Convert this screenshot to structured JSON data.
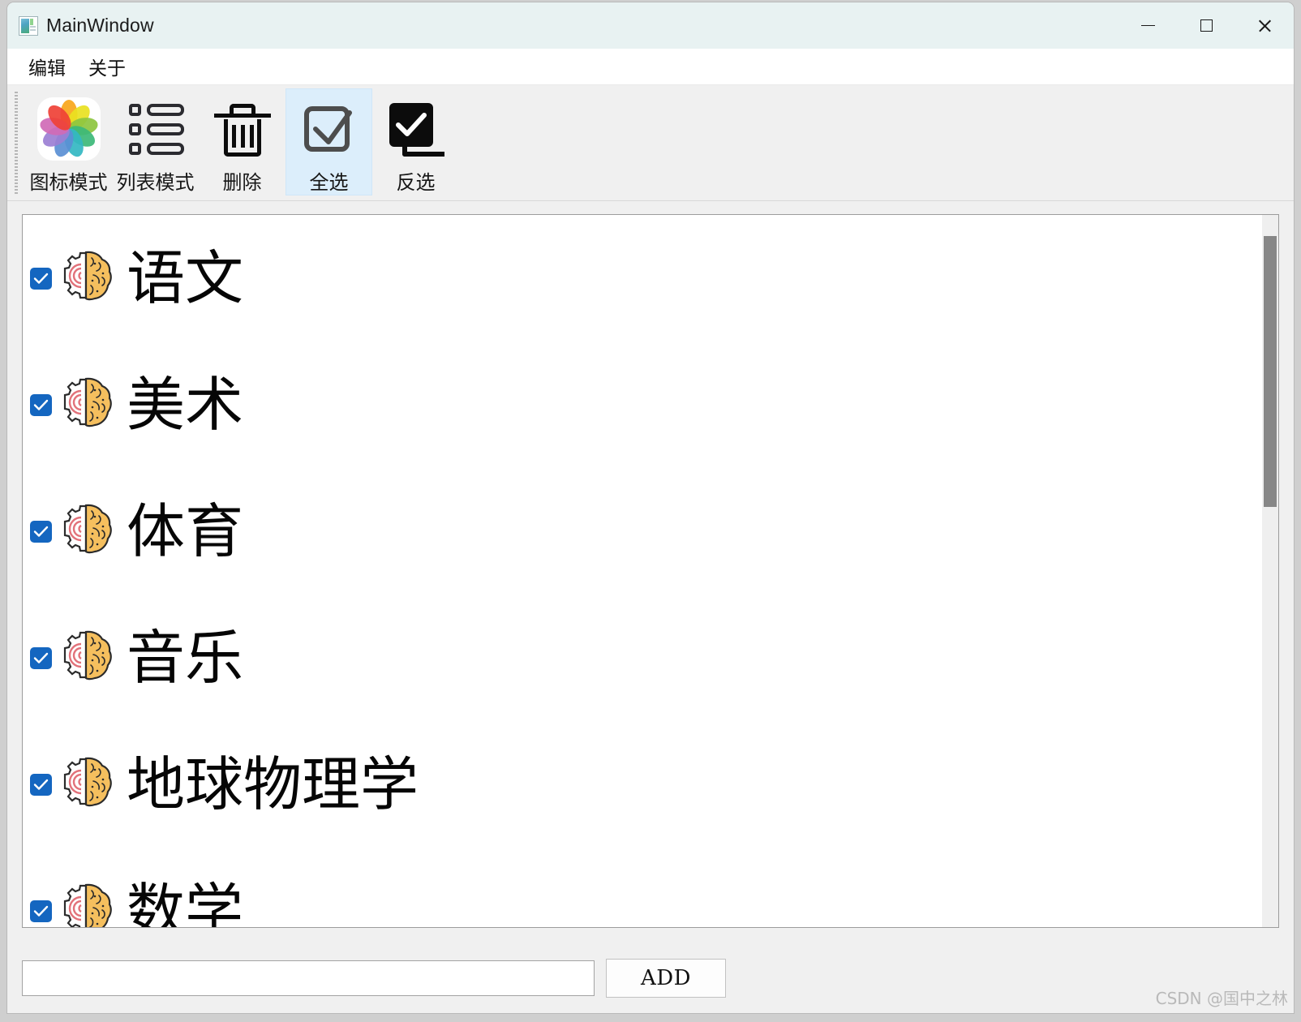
{
  "window": {
    "title": "MainWindow",
    "app_icon": "app-window-icon",
    "controls": {
      "minimize": "minimize-icon",
      "maximize": "maximize-icon",
      "close": "close-icon"
    }
  },
  "menubar": {
    "items": [
      {
        "label": "编辑",
        "name": "menu-edit"
      },
      {
        "label": "关于",
        "name": "menu-about"
      }
    ]
  },
  "toolbar": {
    "buttons": [
      {
        "label": "图标模式",
        "icon": "photos-grid-icon",
        "selected": false
      },
      {
        "label": "列表模式",
        "icon": "list-view-icon",
        "selected": false
      },
      {
        "label": "删除",
        "icon": "trash-icon",
        "selected": false
      },
      {
        "label": "全选",
        "icon": "checkbox-check-icon",
        "selected": true
      },
      {
        "label": "反选",
        "icon": "invert-selection-icon",
        "selected": false
      }
    ],
    "selected_color": "#dceefb"
  },
  "list": {
    "checkbox_color": "#1466c0",
    "item_icon": "brain-gear-icon",
    "items": [
      {
        "label": "语文",
        "checked": true
      },
      {
        "label": "美术",
        "checked": true
      },
      {
        "label": "体育",
        "checked": true
      },
      {
        "label": "音乐",
        "checked": true
      },
      {
        "label": "地球物理学",
        "checked": true
      },
      {
        "label": "数学",
        "checked": true
      }
    ],
    "scrollbar": {
      "thumb_color": "#878787",
      "thumb_top_pct": 3,
      "thumb_height_pct": 38
    }
  },
  "bottom": {
    "input_value": "",
    "input_placeholder": "",
    "add_label": "ADD"
  },
  "watermark": {
    "text": "CSDN @国中之林"
  }
}
